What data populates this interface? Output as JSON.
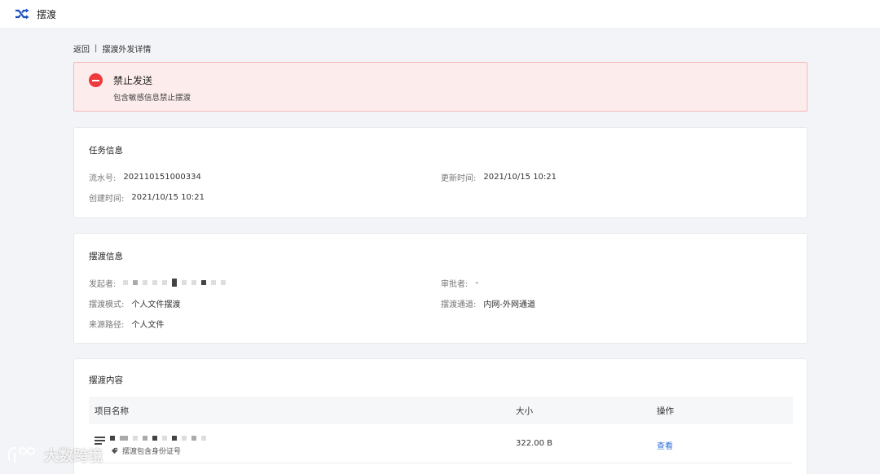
{
  "app": {
    "title": "摆渡",
    "logo_icon": "shuffle-icon",
    "accent": "#1f4fbf"
  },
  "breadcrumb": {
    "back": "返回",
    "separator": "|",
    "current": "摆渡外发详情"
  },
  "alert": {
    "icon": "minus-circle-icon",
    "title": "禁止发送",
    "description": "包含敏感信息禁止摆渡",
    "color": "#f0393d"
  },
  "task_info": {
    "title": "任务信息",
    "serial_label": "流水号:",
    "serial_value": "202110151000334",
    "updated_label": "更新时间:",
    "updated_value": "2021/10/15 10:21",
    "created_label": "创建时间:",
    "created_value": "2021/10/15 10:21"
  },
  "ferry_info": {
    "title": "摆渡信息",
    "initiator_label": "发起者:",
    "approver_label": "审批者:",
    "approver_value": "-",
    "mode_label": "摆渡模式:",
    "mode_value": "个人文件摆渡",
    "channel_label": "摆渡通道:",
    "channel_value": "内网-外网通道",
    "source_label": "来源路径:",
    "source_value": "个人文件"
  },
  "ferry_content": {
    "title": "摆渡内容",
    "columns": {
      "name": "项目名称",
      "size": "大小",
      "op": "操作"
    },
    "rows": [
      {
        "tag": "摆渡包含身份证号",
        "size": "322.00 B",
        "op": "查看"
      }
    ]
  },
  "watermark": {
    "text": "大数跨境"
  }
}
